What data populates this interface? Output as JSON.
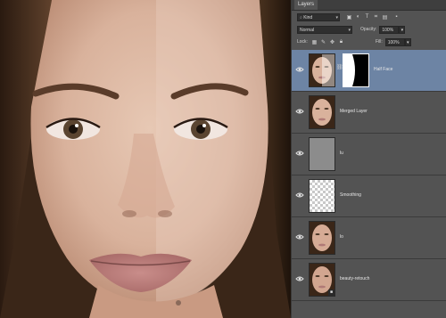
{
  "panel": {
    "tab_label": "Layers",
    "filter": {
      "value": "Kind"
    },
    "blend": {
      "value": "Normal"
    },
    "opacity": {
      "label": "Opacity:",
      "value": "100%"
    },
    "lock": {
      "label": "Lock:"
    },
    "fill": {
      "label": "Fill:",
      "value": "100%"
    },
    "filter_icons": [
      "image-filter-icon",
      "adjustment-filter-icon",
      "type-filter-icon",
      "shape-filter-icon",
      "smart-object-filter-icon"
    ],
    "lock_icons": [
      "lock-pixels-icon",
      "lock-image-icon",
      "lock-position-icon",
      "lock-all-icon"
    ]
  },
  "layers": [
    {
      "name": "Half Face",
      "selected": true,
      "thumb": "face",
      "has_mask": true
    },
    {
      "name": "Merged Layer",
      "selected": false,
      "thumb": "face",
      "has_mask": false
    },
    {
      "name": "lu",
      "selected": false,
      "thumb": "grey",
      "has_mask": false
    },
    {
      "name": "Smoothing",
      "selected": false,
      "thumb": "transparent",
      "has_mask": false
    },
    {
      "name": "lo",
      "selected": false,
      "thumb": "face",
      "has_mask": false
    },
    {
      "name": "beauty-retouch",
      "selected": false,
      "thumb": "face",
      "has_mask": false
    }
  ],
  "colors": {
    "panel_bg": "#535353",
    "selected_row": "#6d84a4",
    "dark": "#2f2f2f"
  }
}
